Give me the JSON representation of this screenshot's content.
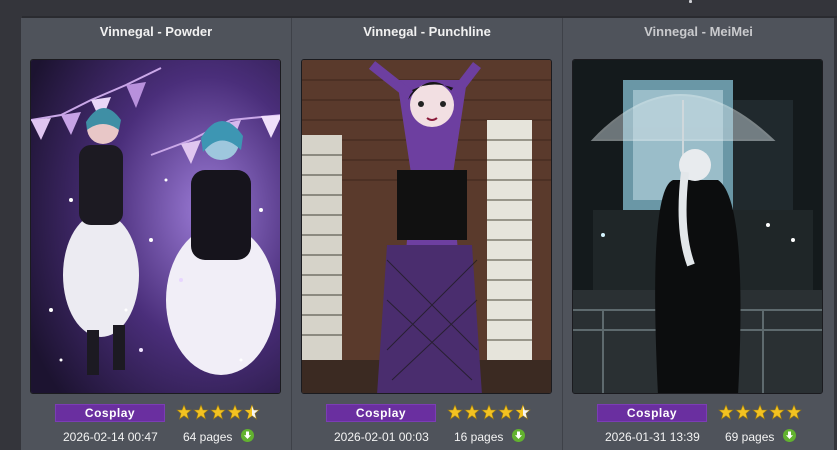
{
  "galleries": [
    {
      "title": "Vinnegal - Powder",
      "category": "Cosplay",
      "rating": 4.5,
      "posted": "2026-02-14 00:47",
      "pages": "64 pages",
      "title_dim": false
    },
    {
      "title": "Vinnegal - Punchline",
      "category": "Cosplay",
      "rating": 4.5,
      "posted": "2026-02-01 00:03",
      "pages": "16 pages",
      "title_dim": false
    },
    {
      "title": "Vinnegal - MeiMei",
      "category": "Cosplay",
      "rating": 5,
      "posted": "2026-01-31 13:39",
      "pages": "69 pages",
      "title_dim": true
    }
  ],
  "icons": {
    "star": "star-icon",
    "download": "download-icon"
  },
  "colors": {
    "cosplay_badge": "#6a2fa0",
    "star_fill": "#f3c221",
    "download": "#62b22f"
  }
}
